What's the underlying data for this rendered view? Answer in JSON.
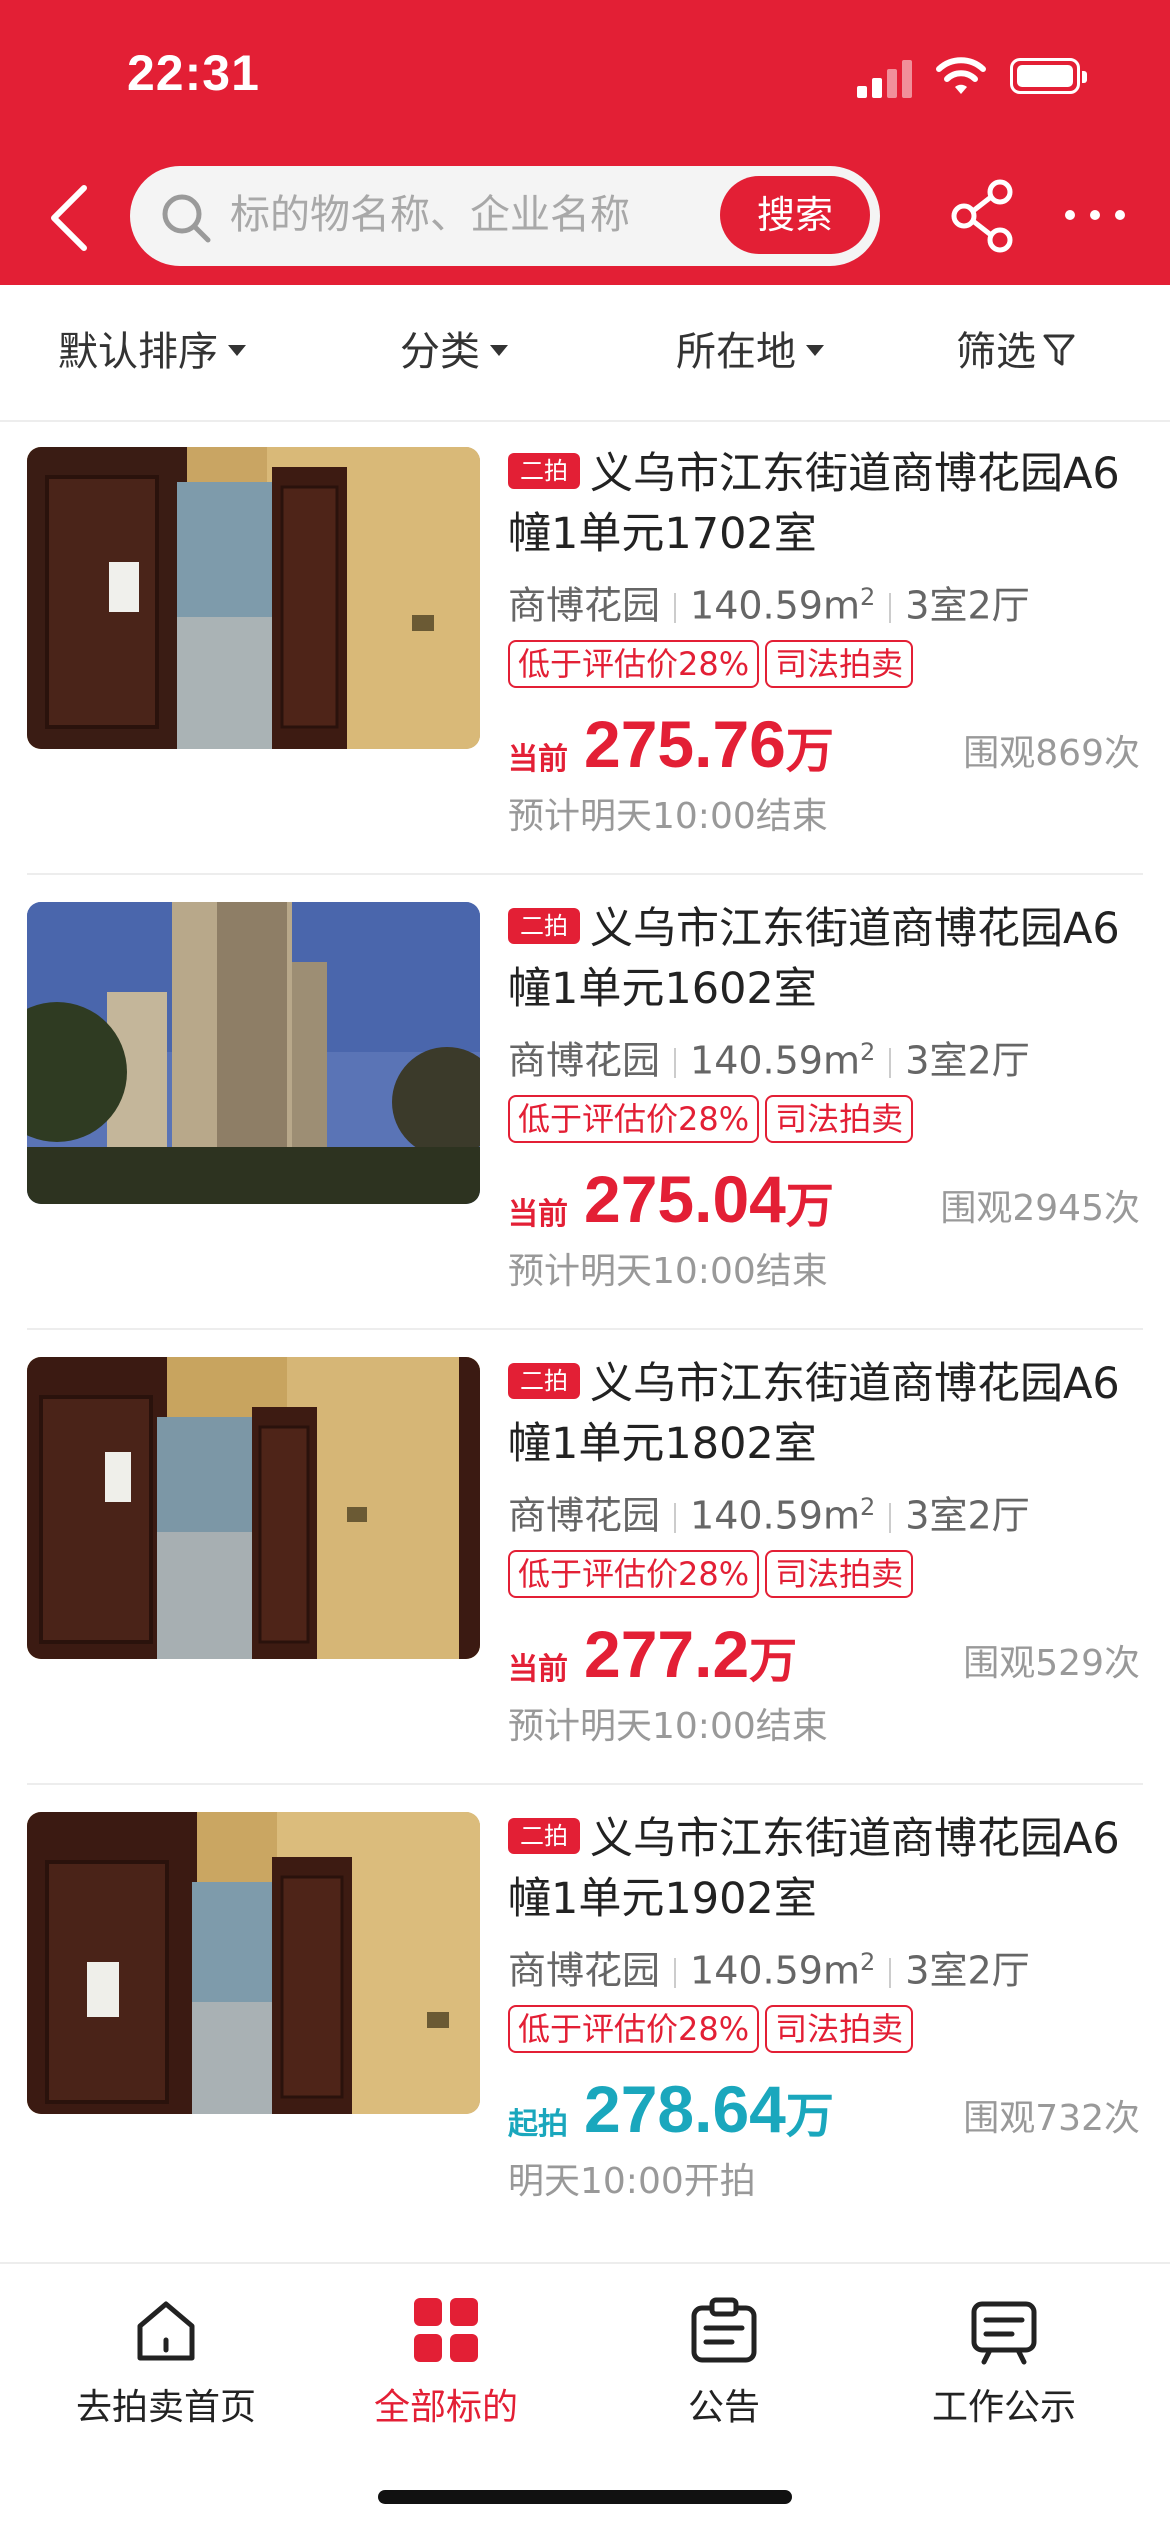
{
  "status_bar": {
    "time": "22:31"
  },
  "nav": {
    "search_placeholder": "标的物名称、企业名称",
    "search_button": "搜索",
    "share_icon": "share-icon",
    "more_icon": "more-icon",
    "back_icon": "chevron-left-icon"
  },
  "filters": [
    {
      "label": "默认排序"
    },
    {
      "label": "分类"
    },
    {
      "label": "所在地"
    },
    {
      "label": "筛选"
    }
  ],
  "listings": [
    {
      "tag": "二拍",
      "title": "义乌市江东街道商博花园A6幢1单元1702室",
      "community": "商博花园",
      "area": "140.59m",
      "area_sup": "2",
      "layout": "3室2厅",
      "badge_discount": "低于评估价28%",
      "badge_type": "司法拍卖",
      "price_label": "当前",
      "price": "275.76",
      "price_unit": "万",
      "views": "围观869次",
      "end_time": "预计明天10:00结束",
      "price_color": "#e31f35"
    },
    {
      "tag": "二拍",
      "title": "义乌市江东街道商博花园A6幢1单元1602室",
      "community": "商博花园",
      "area": "140.59m",
      "area_sup": "2",
      "layout": "3室2厅",
      "badge_discount": "低于评估价28%",
      "badge_type": "司法拍卖",
      "price_label": "当前",
      "price": "275.04",
      "price_unit": "万",
      "views": "围观2945次",
      "end_time": "预计明天10:00结束",
      "price_color": "#e31f35"
    },
    {
      "tag": "二拍",
      "title": "义乌市江东街道商博花园A6幢1单元1802室",
      "community": "商博花园",
      "area": "140.59m",
      "area_sup": "2",
      "layout": "3室2厅",
      "badge_discount": "低于评估价28%",
      "badge_type": "司法拍卖",
      "price_label": "当前",
      "price": "277.2",
      "price_unit": "万",
      "views": "围观529次",
      "end_time": "预计明天10:00结束",
      "price_color": "#e31f35"
    },
    {
      "tag": "二拍",
      "title": "义乌市江东街道商博花园A6幢1单元1902室",
      "community": "商博花园",
      "area": "140.59m",
      "area_sup": "2",
      "layout": "3室2厅",
      "badge_discount": "低于评估价28%",
      "badge_type": "司法拍卖",
      "price_label": "起拍",
      "price": "278.64",
      "price_unit": "万",
      "views": "围观732次",
      "end_time": "明天10:00开拍",
      "price_color": "#1aa7bd"
    }
  ],
  "tabs": [
    {
      "label": "去拍卖首页",
      "icon": "home-icon",
      "active": false
    },
    {
      "label": "全部标的",
      "icon": "grid-icon",
      "active": true
    },
    {
      "label": "公告",
      "icon": "clipboard-icon",
      "active": false
    },
    {
      "label": "工作公示",
      "icon": "notice-board-icon",
      "active": false
    }
  ],
  "colors": {
    "brand": "#e31f35",
    "start_price": "#1aa7bd"
  }
}
